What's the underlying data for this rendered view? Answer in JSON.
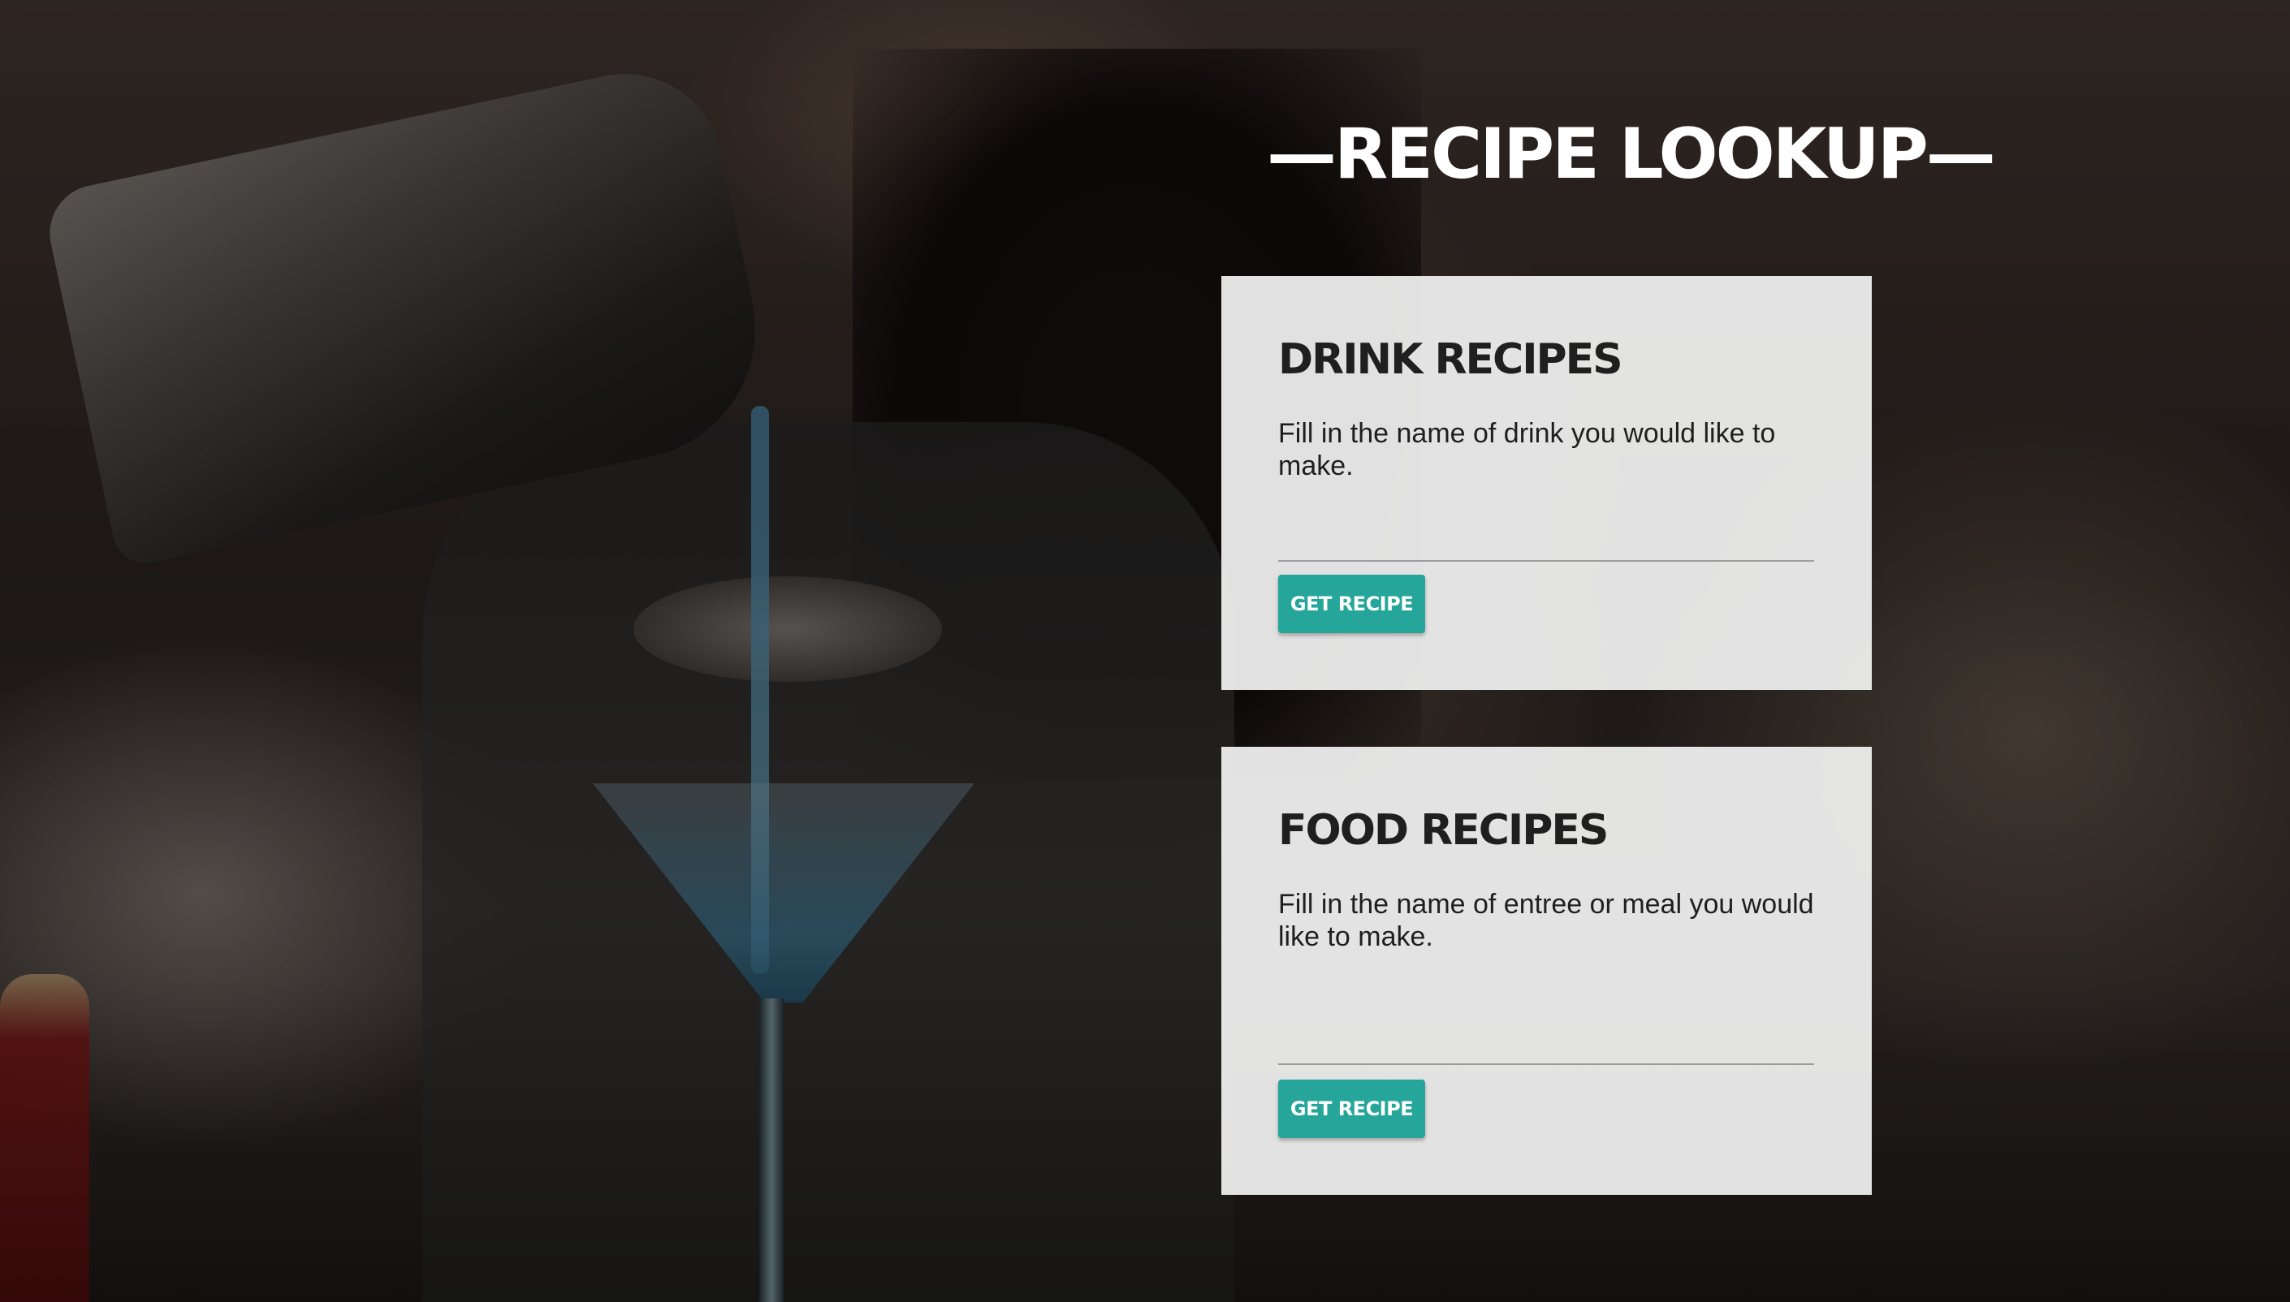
{
  "header": {
    "title": "—RECIPE LOOKUP—"
  },
  "drink_card": {
    "heading": "DRINK RECIPES",
    "description": "Fill in the name of drink you would like to make.",
    "input_value": "",
    "button_label": "GET RECIPE"
  },
  "food_card": {
    "heading": "FOOD RECIPES",
    "description": "Fill in the name of entree or meal you would like to make.",
    "input_value": "",
    "button_label": "GET RECIPE"
  },
  "colors": {
    "accent": "#26a69a",
    "card_background": "#f2f2f2",
    "title_text": "#ffffff",
    "body_text": "#1f1f1f"
  }
}
